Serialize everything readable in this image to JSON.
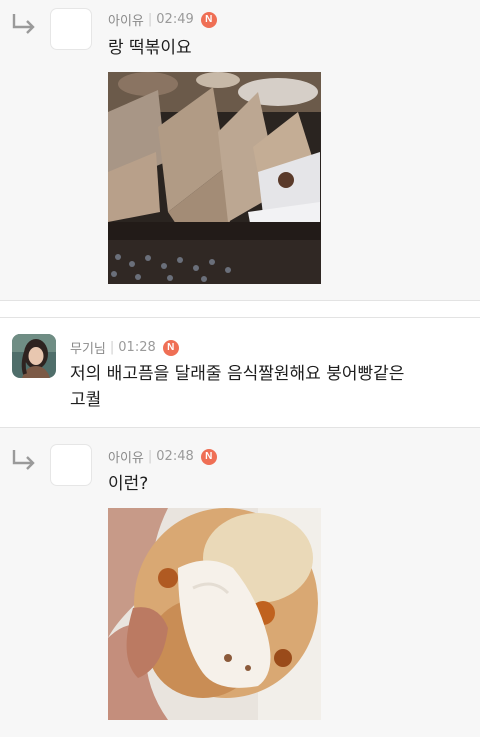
{
  "comments": [
    {
      "author": "아이유",
      "time": "02:49",
      "badge": "N",
      "text": "랑 떡볶이요",
      "is_reply": true,
      "image_icon": "rice-cake-photo"
    },
    {
      "author": "무기님",
      "time": "01:28",
      "badge": "N",
      "text_lines": [
        "저의 배고픔을 달래줄 음식짤원해요 붕어빵같은",
        "고퀄"
      ],
      "is_reply": false,
      "avatar_icon": "profile-avatar"
    },
    {
      "author": "아이유",
      "time": "02:48",
      "badge": "N",
      "text": "이런?",
      "is_reply": true,
      "image_icon": "scone-cream-photo"
    }
  ],
  "colors": {
    "badge": "#ef6f55",
    "reply_bg": "#f7f7f7",
    "meta_text": "#8a8a8a"
  }
}
